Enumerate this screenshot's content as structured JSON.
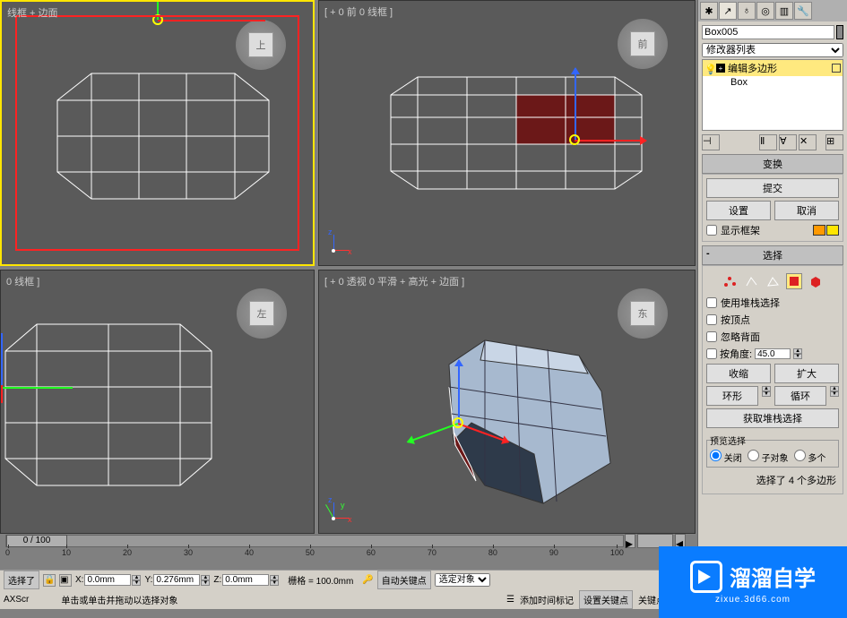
{
  "viewports": {
    "top_label": "线框 + 边面",
    "front_label": "[ + 0 前 0 线框 ]",
    "left_label": "0 线框 ]",
    "persp_label": "[ + 0 透视 0 平滑 + 高光 + 边面 ]",
    "viewcube_top": "上",
    "viewcube_front": "前",
    "viewcube_left": "左",
    "viewcube_persp": "东"
  },
  "axes": {
    "x": "x",
    "y": "y",
    "z": "z"
  },
  "panel": {
    "object_name": "Box005",
    "modifier_list_placeholder": "修改器列表",
    "stack": {
      "item1": "编辑多边形",
      "item2": "Box"
    }
  },
  "rollouts": {
    "transform": "变换",
    "commit": "提交",
    "settings": "设置",
    "cancel": "取消",
    "show_cage": "显示框架",
    "selection": "选择",
    "use_stack_sel": "使用堆栈选择",
    "by_vertex": "按顶点",
    "ignore_back": "忽略背面",
    "by_angle": "按角度:",
    "angle_value": "45.0",
    "shrink": "收缩",
    "grow": "扩大",
    "ring": "环形",
    "loop": "循环",
    "get_stack_sel": "获取堆栈选择",
    "preview_sel": "预览选择",
    "off": "关闭",
    "subobj": "子对象",
    "multi": "多个",
    "sel_status": "选择了 4 个多边形"
  },
  "timeline": {
    "marker": "0 / 100",
    "ticks": [
      "0",
      "10",
      "20",
      "30",
      "40",
      "50",
      "60",
      "70",
      "80",
      "90",
      "100"
    ]
  },
  "status": {
    "selected": "选择了",
    "x_label": "X:",
    "x_val": "0.0mm",
    "y_label": "Y:",
    "y_val": "0.276mm",
    "z_label": "Z:",
    "z_val": "0.0mm",
    "grid": "栅格 = 100.0mm",
    "autokey": "自动关键点",
    "sel_filter": "选定对象",
    "set_key": "设置关键点",
    "key_filter": "关键点过滤器",
    "axscr": "AXScr",
    "hint": "单击或单击并拖动以选择对象",
    "add_time_tag": "添加时间标记"
  },
  "watermark": {
    "text": "溜溜自学",
    "url": "zixue.3d66.com"
  }
}
